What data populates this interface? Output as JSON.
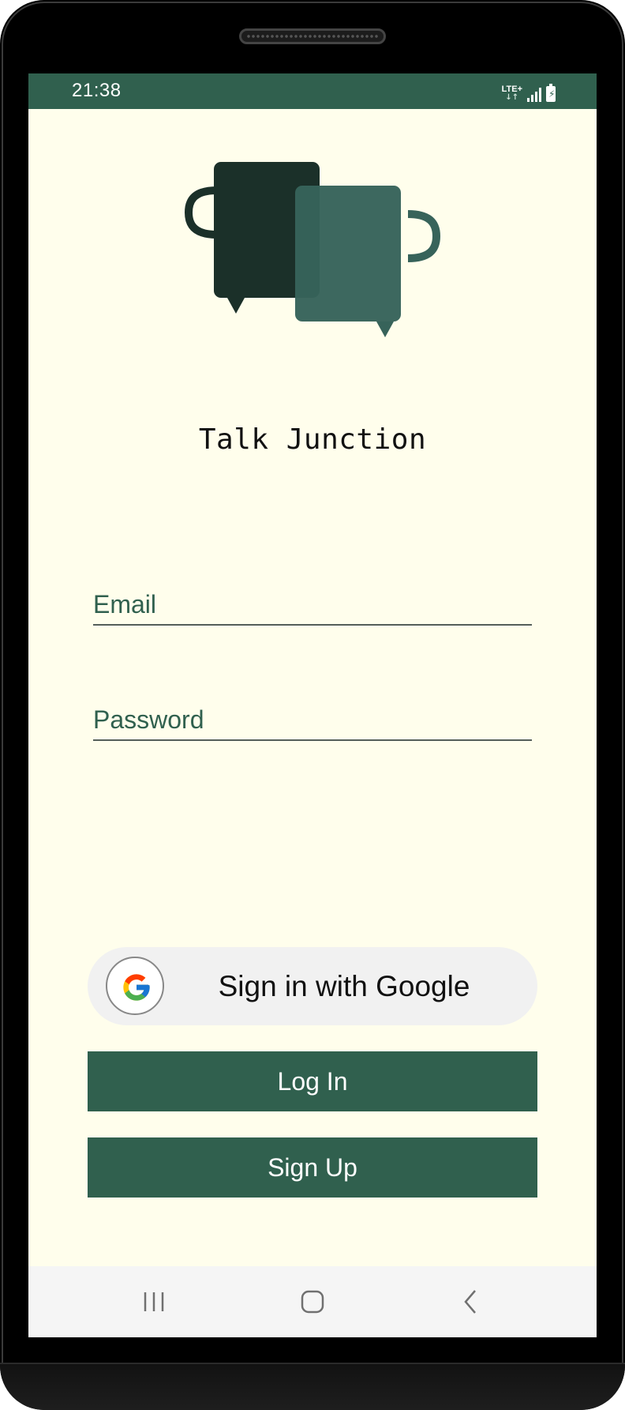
{
  "status_bar": {
    "time": "21:38",
    "network": "LTE+",
    "network_arrows": "↓↑"
  },
  "app": {
    "title": "Talk Junction",
    "logo_icon": "two-mugs-chat-bubbles-icon"
  },
  "form": {
    "email_placeholder": "Email",
    "email_value": "",
    "password_placeholder": "Password",
    "password_value": ""
  },
  "buttons": {
    "google_label": "Sign in with Google",
    "login_label": "Log In",
    "signup_label": "Sign Up"
  },
  "nav": {
    "recents_icon": "recents-icon",
    "home_icon": "home-icon",
    "back_icon": "back-icon"
  },
  "colors": {
    "primary": "#30604e",
    "background": "#fffeec",
    "logo_dark": "#1b3029",
    "logo_light": "#37635a"
  }
}
